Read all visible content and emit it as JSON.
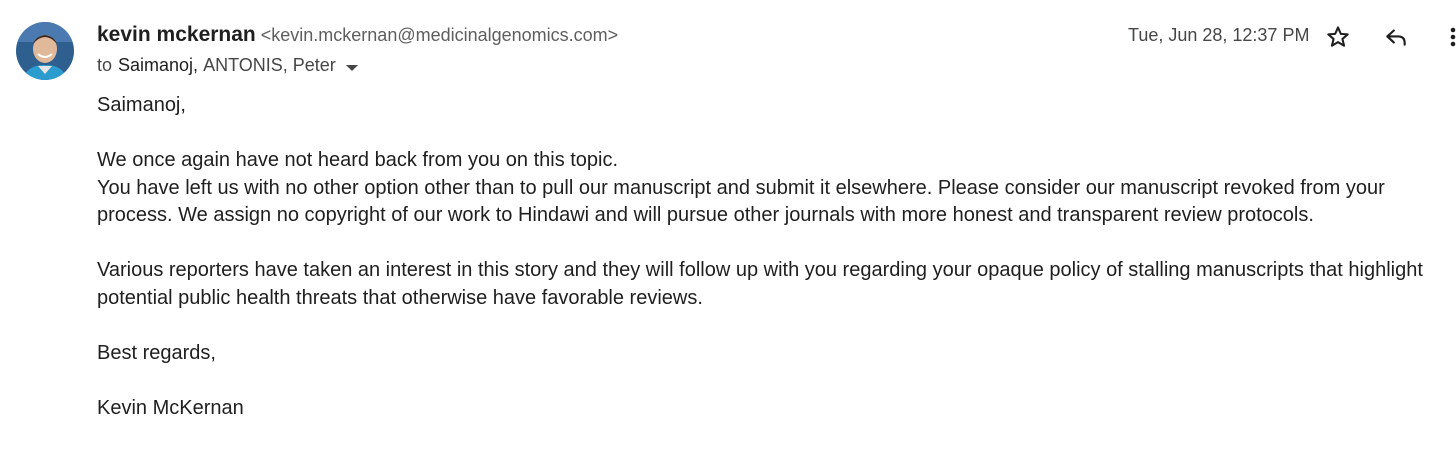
{
  "header": {
    "sender_name": "kevin mckernan",
    "sender_email": "<kevin.mckernan@medicinalgenomics.com>",
    "to_label": "to",
    "first_recipient": "Saimanoj,",
    "other_recipients": "ANTONIS, Peter",
    "date": "Tue, Jun 28, 12:37 PM"
  },
  "icons": {
    "avatar": "sender-avatar",
    "star": "star-icon",
    "reply": "reply-icon",
    "more": "more-vert-icon",
    "dropdown": "chevron-down-icon"
  },
  "body": {
    "greeting": "Saimanoj,",
    "para1_line1": "We once again have not heard back from you on this topic.",
    "para1_line2": "You have left us with no other option other than to pull our manuscript and submit it elsewhere. Please consider our manuscript revoked from your process. We assign no copyright of our work to Hindawi and will pursue other journals with more honest and transparent review protocols.",
    "para2": "Various reporters have taken an interest in this story and they will follow up with you regarding your opaque policy of stalling manuscripts that highlight potential public health threats that otherwise have favorable reviews.",
    "closing": "Best regards,",
    "signature": "Kevin McKernan"
  },
  "colors": {
    "avatar_bg": "#2f5f8f",
    "text_primary": "#1f1f1f",
    "text_secondary": "#444746"
  }
}
